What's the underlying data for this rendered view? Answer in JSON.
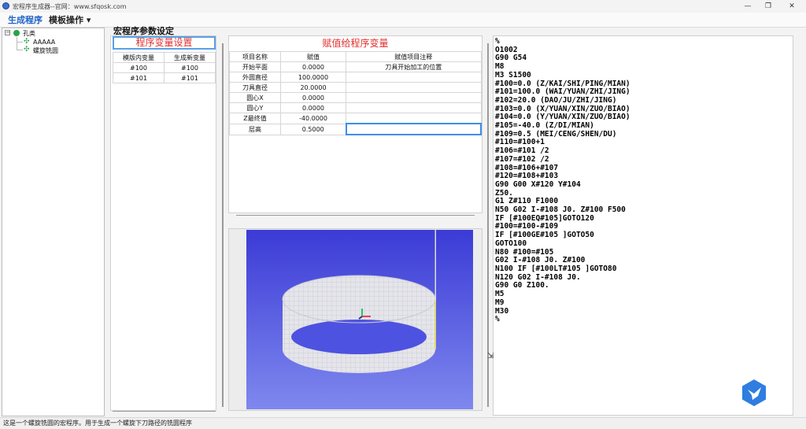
{
  "window": {
    "title": "宏程序生成器--官网：www.sfqosk.com",
    "minimize": "—",
    "maximize": "❐",
    "close": "✕"
  },
  "menu": {
    "generate": "生成程序",
    "template": "模板操作 ▾"
  },
  "tree": {
    "root": "孔类",
    "children": [
      "AAAAA",
      "螺旋铣圆"
    ]
  },
  "settings_title": "宏程序参数设定",
  "var_panel": {
    "header": "程序变量设置",
    "columns": [
      "模版内变量",
      "生成新变量"
    ],
    "rows": [
      [
        "#100",
        "#100"
      ],
      [
        "#101",
        "#101"
      ]
    ]
  },
  "assign_panel": {
    "title": "赋值给程序变量",
    "columns": [
      "项目名称",
      "赋值",
      "赋值项目注释"
    ],
    "rows": [
      [
        "开始平面",
        "0.0000",
        "刀具开始加工的位置"
      ],
      [
        "外圆直径",
        "100.0000",
        ""
      ],
      [
        "刀具直径",
        "20.0000",
        ""
      ],
      [
        "圆心X",
        "0.0000",
        ""
      ],
      [
        "圆心Y",
        "0.0000",
        ""
      ],
      [
        "Z最终值",
        "-40.0000",
        ""
      ],
      [
        "层高",
        "0.5000",
        ""
      ]
    ]
  },
  "code_lines": [
    "%",
    "O1002",
    "G90 G54",
    "M8",
    "M3 S1500",
    "#100=0.0 (Z/KAI/SHI/PING/MIAN)",
    "#101=100.0 (WAI/YUAN/ZHI/JING)",
    "#102=20.0 (DAO/JU/ZHI/JING)",
    "#103=0.0 (X/YUAN/XIN/ZUO/BIAO)",
    "#104=0.0 (Y/YUAN/XIN/ZUO/BIAO)",
    "#105=-40.0 (Z/DI/MIAN)",
    "#109=0.5 (MEI/CENG/SHEN/DU)",
    "#110=#100+1",
    "#106=#101 /2",
    "#107=#102 /2",
    "#108=#106+#107",
    "#120=#108+#103",
    "G90 G00 X#120 Y#104",
    "Z50.",
    "G1 Z#110 F1000",
    "N50 G02 I-#108 J0. Z#100 F500",
    "IF [#100EQ#105]GOTO120",
    "#100=#100-#109",
    "IF [#100GE#105 ]GOTO50",
    "GOTO100",
    "N80 #100=#105",
    "G02 I-#108 J0. Z#100",
    "N100 IF [#100LT#105 ]GOTO80",
    "N120 G02 I-#108 J0.",
    "G90 G0 Z100.",
    "M5",
    "M9",
    "M30",
    "%"
  ],
  "status": "这是一个螺旋铣圆的宏程序。用于生成一个螺旋下刀路径的铣圆程序",
  "colors": {
    "accent": "#1e63c8",
    "header_red": "#e0312f",
    "viewport_top": "#3b3bd6",
    "viewport_bottom": "#7f88ee"
  }
}
